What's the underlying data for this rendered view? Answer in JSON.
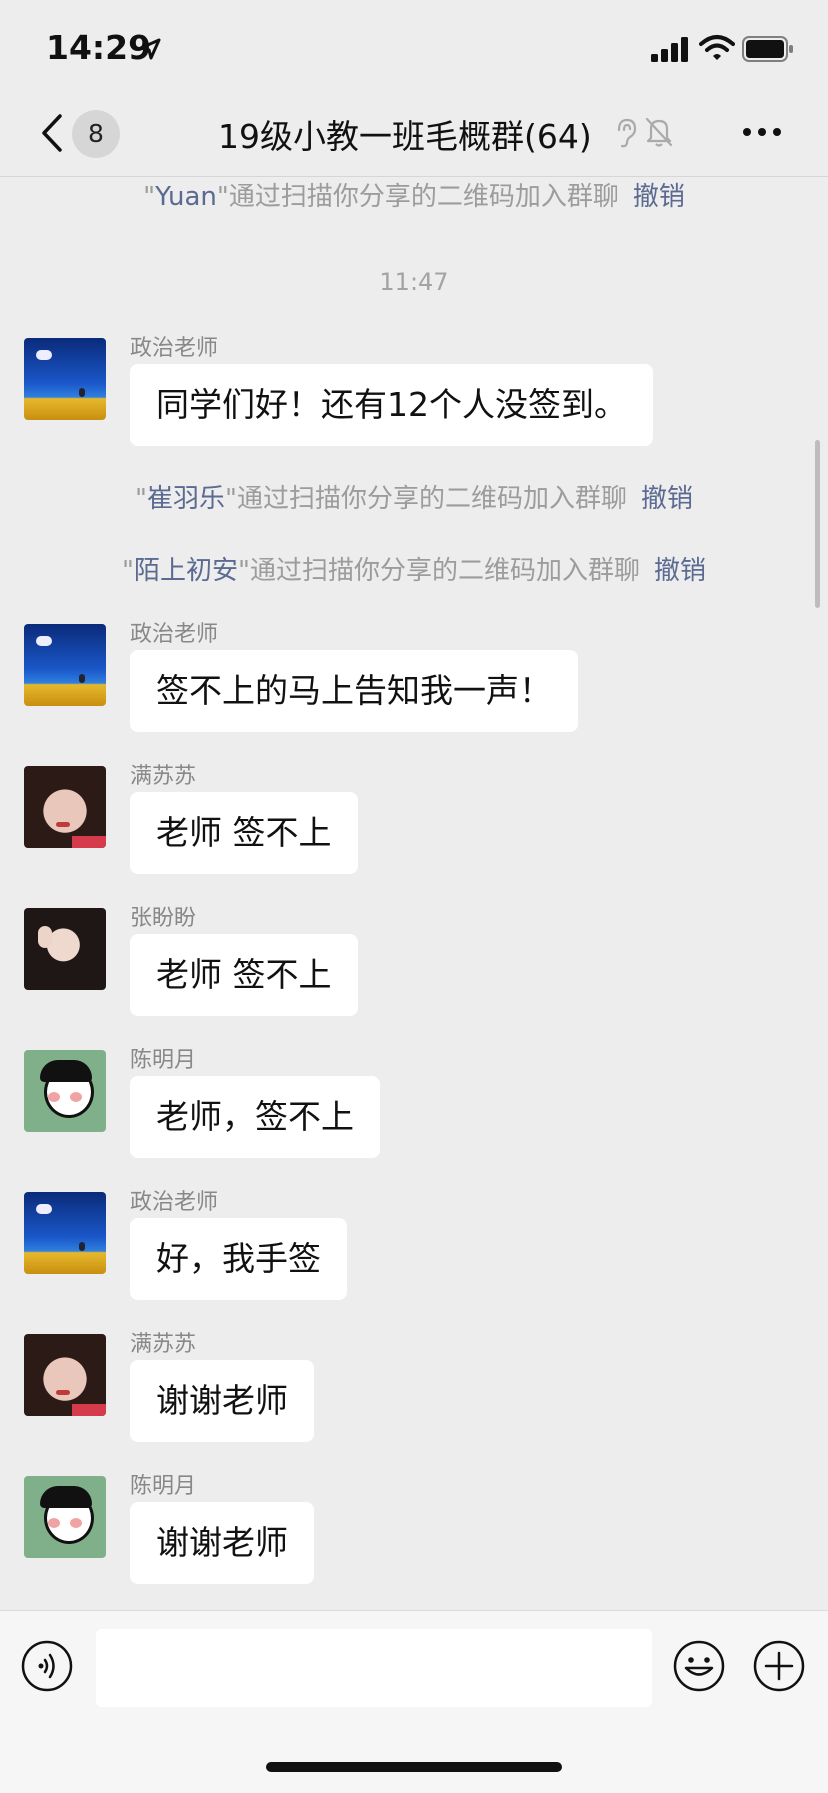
{
  "status_bar": {
    "time": "14:29"
  },
  "nav": {
    "unread_count": "8",
    "title": "19级小教一班毛概群(64)"
  },
  "messages": {
    "join_yuan": {
      "quote_open": "\"",
      "name": "Yuan",
      "quote_close": "\"",
      "text": "通过扫描你分享的二维码加入群聊",
      "action": "撤销"
    },
    "time_1147": "11:47",
    "m1": {
      "sender": "政治老师",
      "text": "同学们好！还有12个人没签到。"
    },
    "join_cui": {
      "quote_open": "\"",
      "name": "崔羽乐",
      "quote_close": "\"",
      "text": "通过扫描你分享的二维码加入群聊",
      "action": "撤销"
    },
    "join_mo": {
      "quote_open": "\"",
      "name": "陌上初安",
      "quote_close": "\"",
      "text": "通过扫描你分享的二维码加入群聊",
      "action": "撤销"
    },
    "m2": {
      "sender": "政治老师",
      "text": "签不上的马上告知我一声！"
    },
    "m3": {
      "sender": "满苏苏",
      "text": "老师 签不上"
    },
    "m4": {
      "sender": "张盼盼",
      "text": "老师 签不上"
    },
    "m5": {
      "sender": "陈明月",
      "text": "老师，签不上"
    },
    "m6": {
      "sender": "政治老师",
      "text": "好，我手签"
    },
    "m7": {
      "sender": "满苏苏",
      "text": "谢谢老师"
    },
    "m8": {
      "sender": "陈明月",
      "text": "谢谢老师"
    }
  },
  "input": {
    "value": ""
  },
  "icons": {
    "back": "chevron-left-icon",
    "ear": "ear-icon",
    "mute": "bell-slash-icon",
    "more": "more-dots-icon",
    "voice": "voice-icon",
    "emoji": "emoji-icon",
    "plus": "plus-icon"
  },
  "colors": {
    "background": "#ededed",
    "link": "#5b6a91",
    "bubble": "#ffffff"
  }
}
